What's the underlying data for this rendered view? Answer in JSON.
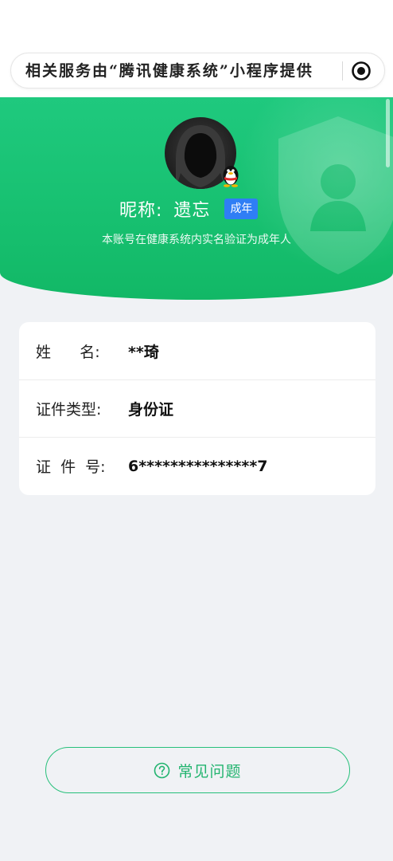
{
  "capsule": {
    "text": "相关服务由“腾讯健康系统”小程序提供",
    "record_icon": "record-icon"
  },
  "profile": {
    "nickname_label": "昵称:",
    "nickname": "遗忘",
    "age_badge": "成年",
    "verify_note": "本账号在健康系统内实名验证为成年人",
    "avatar_icon": "avatar",
    "qq_icon": "qq-penguin-icon"
  },
  "info": {
    "rows": [
      {
        "label": "姓      名:",
        "value": "**琦"
      },
      {
        "label": "证件类型:",
        "value": "身份证"
      },
      {
        "label": "证  件  号:",
        "value": "6***************7"
      }
    ]
  },
  "faq": {
    "label": "常见问题",
    "icon": "question-circle-icon"
  },
  "colors": {
    "brand_green": "#1fc97e",
    "badge_blue": "#2f7ef5",
    "faq_green": "#22b46f",
    "background": "#f0f2f5"
  }
}
